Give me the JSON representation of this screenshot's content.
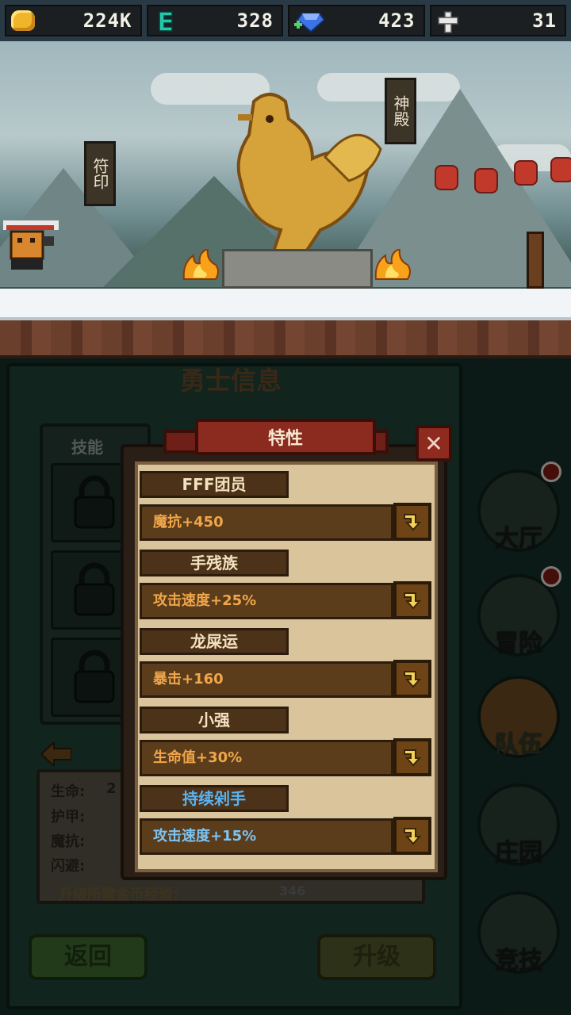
{
  "resources": {
    "gold": "224K",
    "ether": "328",
    "gems": "423",
    "crosses": "31"
  },
  "scene": {
    "sign_left": "符印",
    "sign_right": "神殿"
  },
  "panel": {
    "title": "勇士信息",
    "skills_label": "技能",
    "stats": {
      "hp_label": "生命:",
      "hp_value": "2",
      "armor_label": "护甲:",
      "mres_label": "魔抗:",
      "dodge_label": "闪避:"
    },
    "upgrade_cost_label": "升级所需金币经验:",
    "upgrade_exp_value": "346",
    "back_button": "返回",
    "upgrade_button": "升级"
  },
  "nav": [
    {
      "label": "大厅",
      "icon": "hall-gate-icon",
      "badge": true
    },
    {
      "label": "冒险",
      "icon": "adventure-cube-icon",
      "badge": true
    },
    {
      "label": "队伍",
      "icon": "team-icon",
      "badge": false
    },
    {
      "label": "庄园",
      "icon": "manor-tree-icon",
      "badge": false
    },
    {
      "label": "竞技",
      "icon": "arena-icon",
      "badge": false
    }
  ],
  "modal": {
    "title": "特性",
    "close": "✕",
    "traits": [
      {
        "name": "FFF团员",
        "effect": "魔抗+450",
        "color": "normal"
      },
      {
        "name": "手残族",
        "effect": "攻击速度+25%",
        "color": "normal"
      },
      {
        "name": "龙屎运",
        "effect": "暴击+160",
        "color": "normal"
      },
      {
        "name": "小强",
        "effect": "生命值+30%",
        "color": "normal"
      },
      {
        "name": "持续剁手",
        "effect": "攻击速度+15%",
        "color": "blue"
      }
    ]
  },
  "colors": {
    "gold_icon": "#f0b52a",
    "ether_icon": "#25c6a9",
    "gem_icon": "#3c74e6",
    "trait_orange": "#f0a64a",
    "trait_blue": "#7cc4f4",
    "ribbon_red": "#8b2a1f"
  }
}
